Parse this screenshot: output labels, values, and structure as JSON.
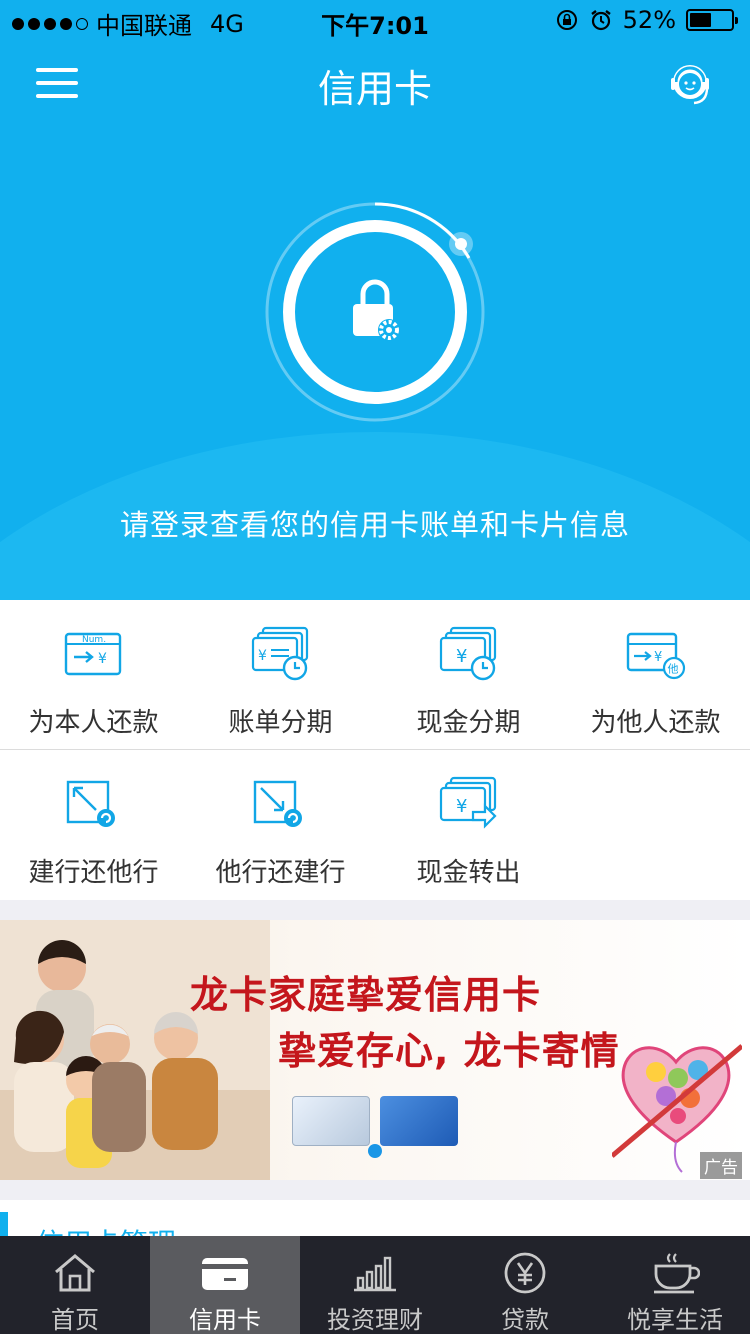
{
  "status_bar": {
    "carrier": "中国联通",
    "network": "4G",
    "time": "下午7:01",
    "battery": "52%",
    "battery_level": 0.52
  },
  "header": {
    "title": "信用卡"
  },
  "hero": {
    "login_hint": "请登录查看您的信用卡账单和卡片信息"
  },
  "functions": [
    {
      "label": "为本人还款",
      "icon": "repay-self-icon"
    },
    {
      "label": "账单分期",
      "icon": "bill-installment-icon"
    },
    {
      "label": "现金分期",
      "icon": "cash-installment-icon"
    },
    {
      "label": "为他人还款",
      "icon": "repay-others-icon"
    },
    {
      "label": "建行还他行",
      "icon": "ccb-to-other-bank-icon"
    },
    {
      "label": "他行还建行",
      "icon": "other-bank-to-ccb-icon"
    },
    {
      "label": "现金转出",
      "icon": "cash-transfer-out-icon"
    }
  ],
  "banner": {
    "line1": "龙卡家庭挚爱信用卡",
    "line2": "挚爱存心, 龙卡寄情",
    "ad_tag": "广告"
  },
  "section": {
    "title_peek": "信用卡管理"
  },
  "tabs": [
    {
      "label": "首页",
      "icon": "home-icon",
      "active": false
    },
    {
      "label": "信用卡",
      "icon": "credit-card-icon",
      "active": true
    },
    {
      "label": "投资理财",
      "icon": "chart-icon",
      "active": false
    },
    {
      "label": "贷款",
      "icon": "yen-coin-icon",
      "active": false
    },
    {
      "label": "悦享生活",
      "icon": "coffee-cup-icon",
      "active": false
    }
  ],
  "colors": {
    "primary": "#11b0ee",
    "tab_bg": "#22232b",
    "tab_active": "#5a5b5f",
    "banner_red": "#c4161c"
  }
}
